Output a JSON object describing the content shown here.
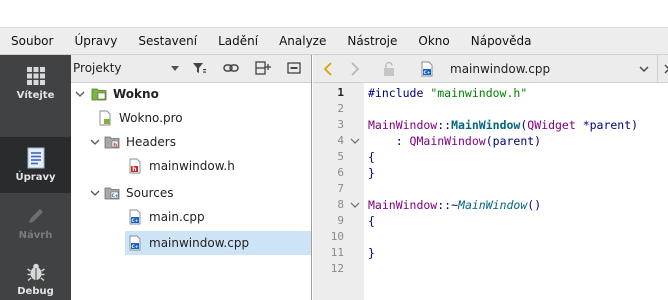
{
  "menubar": {
    "items": [
      "Soubor",
      "Úpravy",
      "Sestavení",
      "Ladění",
      "Analyze",
      "Nástroje",
      "Okno",
      "Nápověda"
    ]
  },
  "modes": [
    {
      "label": "Vítejte",
      "icon": "grid-icon",
      "state": "normal"
    },
    {
      "label": "Úpravy",
      "icon": "document-edit-icon",
      "state": "active"
    },
    {
      "label": "Návrh",
      "icon": "pencil-icon",
      "state": "disabled"
    },
    {
      "label": "Debug",
      "icon": "bug-icon",
      "state": "normal"
    }
  ],
  "projects": {
    "selector_label": "Projekty",
    "tree": [
      {
        "label": "Wokno",
        "icon": "project-folder-icon",
        "bold": true,
        "expanded": true
      },
      {
        "label": "Wokno.pro",
        "icon": "pro-file-icon"
      },
      {
        "label": "Headers",
        "icon": "headers-folder-icon",
        "expanded": true
      },
      {
        "label": "mainwindow.h",
        "icon": "header-file-icon"
      },
      {
        "label": "Sources",
        "icon": "sources-folder-icon",
        "expanded": true
      },
      {
        "label": "main.cpp",
        "icon": "cpp-file-icon"
      },
      {
        "label": "mainwindow.cpp",
        "icon": "cpp-file-icon",
        "selected": true
      }
    ]
  },
  "editor": {
    "file_name": "mainwindow.cpp",
    "current_line": 1,
    "line_numbers": [
      "1",
      "2",
      "3",
      "4",
      "5",
      "6",
      "7",
      "8",
      "9",
      "10",
      "11",
      "12"
    ],
    "lines": {
      "l1_pre": "#include ",
      "l1_str": "\"mainwindow.h\"",
      "l3_cls": "MainWindow",
      "l3_sep": "::",
      "l3_fn": "MainWindow",
      "l3_open": "(",
      "l3_type": "QWidget",
      "l3_rest": " *parent)",
      "l4_pre": "    : ",
      "l4_fn": "QMainWindow",
      "l4_rest": "(parent)",
      "l5": "{",
      "l6": "}",
      "l8_cls": "MainWindow",
      "l8_sep": "::~",
      "l8_fn": "MainWindow",
      "l8_rest": "()",
      "l9": "{",
      "l11": "}"
    }
  },
  "colors": {
    "modebar_bg": "#404244",
    "selection": "#cde4f7",
    "string": "#008000",
    "keyword": "#000080"
  }
}
